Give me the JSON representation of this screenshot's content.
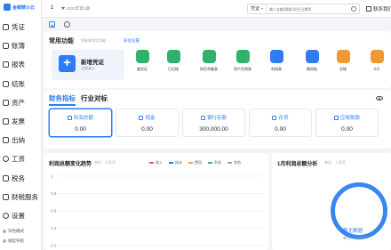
{
  "brand": {
    "name": "金蝶精斗云"
  },
  "sidebar": {
    "items": [
      {
        "label": "凭证",
        "icon": "voucher-icon"
      },
      {
        "label": "账簿",
        "icon": "ledger-icon"
      },
      {
        "label": "报表",
        "icon": "report-icon"
      },
      {
        "label": "结账",
        "icon": "close-books-icon"
      },
      {
        "label": "资产",
        "icon": "asset-icon"
      },
      {
        "label": "发票",
        "icon": "invoice-icon"
      },
      {
        "label": "出纳",
        "icon": "cashier-icon"
      },
      {
        "label": "工资",
        "icon": "salary-icon"
      },
      {
        "label": "税务",
        "icon": "tax-icon"
      },
      {
        "label": "财税服务",
        "icon": "service-icon"
      },
      {
        "label": "设置",
        "icon": "settings-icon"
      }
    ],
    "footer": [
      {
        "label": "深色模式"
      },
      {
        "label": "收起导航"
      }
    ]
  },
  "topbar": {
    "account": "1",
    "period": "2023年第1期",
    "search_type": "凭证",
    "search_placeholder": "输入金额/摘要/科目/日期等",
    "support": "联系我们"
  },
  "common": {
    "title": "常用功能",
    "hint": "您能够常用功能",
    "link": "前往设置",
    "new_voucher": {
      "title": "新增凭证",
      "subtitle": "立即录入"
    },
    "shortcuts": [
      {
        "label": "查凭证",
        "icon": "search-voucher-icon",
        "color": "#2fb36b"
      },
      {
        "label": "日记账",
        "icon": "journal-icon",
        "color": "#2fb36b"
      },
      {
        "label": "科目余额表",
        "icon": "balance-icon",
        "color": "#2fb36b"
      },
      {
        "label": "资产负债表",
        "icon": "balance-sheet-icon",
        "color": "#2fb36b"
      },
      {
        "label": "利润表",
        "icon": "profit-icon",
        "color": "#2f7bf5"
      },
      {
        "label": "期间账",
        "icon": "period-icon",
        "color": "#2f7bf5"
      },
      {
        "label": "总账",
        "icon": "general-ledger-icon",
        "color": "#ef9a2e"
      },
      {
        "label": "卡片",
        "icon": "card-icon",
        "color": "#ef9a2e"
      }
    ]
  },
  "finance": {
    "tabs": [
      "财务指标",
      "行业对标"
    ],
    "metrics": [
      {
        "label": "利润总额",
        "value": "0.00",
        "icon": "profit-total-icon"
      },
      {
        "label": "现金",
        "value": "0.00",
        "icon": "cash-icon"
      },
      {
        "label": "银行存款",
        "value": "300,000.00",
        "icon": "bank-icon"
      },
      {
        "label": "存货",
        "value": "0.00",
        "icon": "inventory-icon"
      },
      {
        "label": "应收账款",
        "value": "0.00",
        "icon": "receivable-icon"
      }
    ]
  },
  "colors": {
    "accent": "#2d7cf6",
    "income": "#e85a5a",
    "cost": "#2f7bf5",
    "expense": "#f0a23b",
    "profit": "#41b36c",
    "other": "#9aa0a8"
  },
  "chart_data": {
    "type": "line",
    "title": "利润总额变化趋势",
    "unit": "单位：人民币",
    "series": [
      {
        "name": "收入",
        "values": []
      },
      {
        "name": "成本",
        "values": []
      },
      {
        "name": "费用",
        "values": []
      },
      {
        "name": "利润",
        "values": []
      },
      {
        "name": "其他",
        "values": []
      }
    ],
    "y_ticks": [
      "1",
      "0.8",
      "0.6",
      "0.4",
      "0.2"
    ],
    "ylim": [
      0.2,
      1
    ],
    "grid": true,
    "legend": "top-right"
  },
  "analysis": {
    "title": "1月利润总额分析",
    "unit": "单位：人民币",
    "empty": "暂无数据",
    "sub": "单位：人民币"
  }
}
